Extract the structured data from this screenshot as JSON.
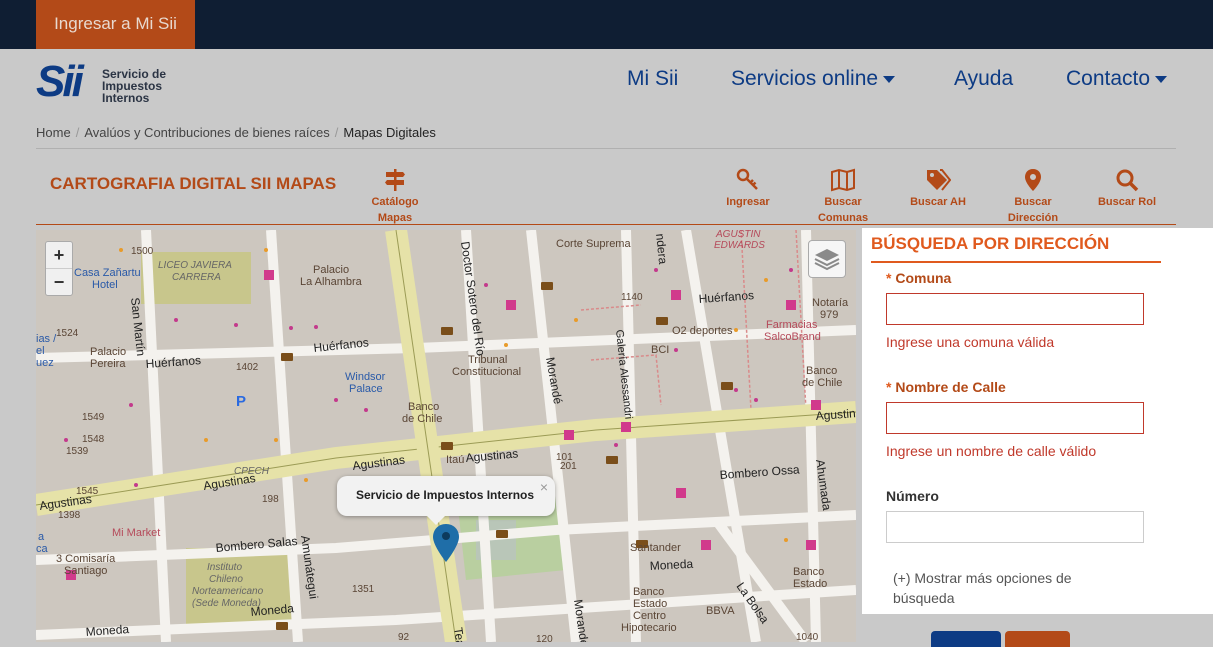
{
  "topbar": {
    "login_label": "Ingresar a Mi Sii"
  },
  "logo": {
    "mark": "Sii",
    "line1": "Servicio de",
    "line2": "Impuestos",
    "line3": "Internos"
  },
  "nav": {
    "mi_sii": "Mi Sii",
    "servicios": "Servicios online",
    "ayuda": "Ayuda",
    "contacto": "Contacto"
  },
  "breadcrumb": {
    "home": "Home",
    "avaluos": "Avalúos y Contribuciones de bienes raíces",
    "current": "Mapas Digitales"
  },
  "page": {
    "title": "CARTOGRAFIA DIGITAL SII MAPAS"
  },
  "tools": {
    "catalogo": [
      "Catálogo",
      "Mapas"
    ],
    "ingresar": "Ingresar",
    "buscar_comunas": [
      "Buscar",
      "Comunas"
    ],
    "buscar_ah": "Buscar AH",
    "buscar_direccion": [
      "Buscar",
      "Dirección"
    ],
    "buscar_rol": "Buscar Rol"
  },
  "map": {
    "zoom_in": "+",
    "zoom_out": "−",
    "popup": "Servicio de Impuestos Internos",
    "popup_close": "×",
    "labels": {
      "hotel": [
        "Casa Zañartu",
        "Hotel"
      ],
      "liceo": [
        "LICEO JAVIERA",
        "CARRERA"
      ],
      "palacio": [
        "Palacio",
        "La Alhambra"
      ],
      "corte": "Corte Suprema",
      "agustin": [
        "AGUSTIN",
        "EDWARDS"
      ],
      "notaria": [
        "Notaría",
        "979"
      ],
      "farmacias": [
        "Farmacias",
        "SalcoBrand"
      ],
      "o2": "O2 deportes",
      "bci": "BCI",
      "tribunal": [
        "Tribunal",
        "Constitucional"
      ],
      "windsor": [
        "Windsor",
        "Palace"
      ],
      "banco_chile": [
        "Banco",
        "de Chile"
      ],
      "banco_chile_r": [
        "Banco",
        "de Chile"
      ],
      "palacio_pereira": [
        "Palacio",
        "Pereira"
      ],
      "itau": "Itaú",
      "cpech": "CPECH",
      "mimarket": "Mi Market",
      "comisaria": [
        "3 Comisaría",
        "Santiago"
      ],
      "instituto": [
        "Instituto",
        "Chileno",
        "Norteamericano",
        "(Sede Moneda)"
      ],
      "santander": "Santander",
      "banco_estado": [
        "Banco",
        "Estado",
        "Centro",
        "Hipotecario"
      ],
      "bbva": "BBVA",
      "banco_estado_r": [
        "Banco",
        "Estado"
      ],
      "ias": [
        "ias /",
        "el",
        "uez"
      ],
      "ca": [
        "a",
        "ca"
      ]
    },
    "streets": {
      "huerfanos_top": "Huérfanos",
      "huerfanos_left": "Huérfanos",
      "huerfanos_mid": "Huérfanos",
      "agustinas_1": "Agustinas",
      "agustinas_2": "Agustinas",
      "agustinas_3": "Agustinas",
      "agustinas_4": "Agustinas",
      "agustinas_right": "Agustina",
      "bombero_salas": "Bombero Salas",
      "bombero_ossa": "Bombero Ossa",
      "moneda_1": "Moneda",
      "moneda_2": "Moneda",
      "moneda_3": "Moneda",
      "san_martin": "San Martín",
      "doctor_sotero": "Doctor Sotero del Río",
      "morande": "Morandé",
      "morande_2": "Morandé",
      "galeria": "Galería Alessandri",
      "amunategui": "Amunátegui",
      "ahumada": "Ahumada",
      "la_bolsa": "La Bolsa",
      "teatinos": "Tea",
      "bandera": "ndera"
    },
    "numbers": [
      "1500",
      "1524",
      "1402",
      "1549",
      "1548",
      "1545",
      "1539",
      "1351",
      "1398",
      "198",
      "201",
      "92",
      "120",
      "101",
      "1040",
      "1140"
    ]
  },
  "search_panel": {
    "title": "BÚSQUEDA POR DIRECCIÓN",
    "required_mark": "*",
    "comuna_label": "Comuna",
    "comuna_value": "",
    "comuna_error": "Ingrese una comuna válida",
    "calle_label": "Nombre de Calle",
    "calle_value": "",
    "calle_error": "Ingrese un nombre de calle válido",
    "numero_label": "Número",
    "numero_value": "",
    "more_options": "(+) Mostrar más opciones de búsqueda"
  },
  "colors": {
    "navy": "#0f1e33",
    "brand_blue": "#0d3b84",
    "accent": "#b34a18",
    "orange_title": "#e05a1e",
    "error": "#c0392b"
  }
}
